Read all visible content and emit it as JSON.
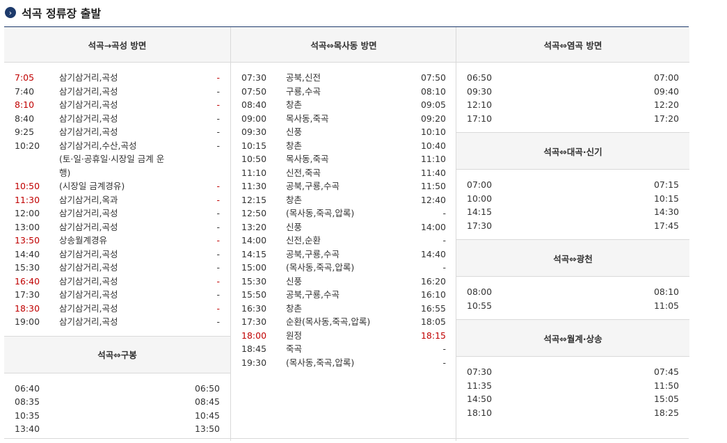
{
  "title": "석곡 정류장 출발",
  "title_icon": "chevron-right-icon",
  "accent_color": "#1d3a6b",
  "highlight_color": "#c00000",
  "sections": {
    "goksung": {
      "header": "석곡→곡성 방면",
      "rows": [
        {
          "time": "7:05",
          "via": "삼기삼거리,곡성",
          "arr": "-",
          "red": true
        },
        {
          "time": "7:40",
          "via": "삼기삼거리,곡성",
          "arr": "-"
        },
        {
          "time": "8:10",
          "via": "삼기삼거리,곡성",
          "arr": "-",
          "red": true
        },
        {
          "time": "8:40",
          "via": "삼기삼거리,곡성",
          "arr": "-"
        },
        {
          "time": "9:25",
          "via": "삼기삼거리,곡성",
          "arr": "-"
        },
        {
          "time": "10:20",
          "via": "삼기삼거리,수산,곡성",
          "arr": "-"
        },
        {
          "time": "",
          "via": "(토·일·공휴일·시장일 금계 운",
          "arr": ""
        },
        {
          "time": "",
          "via": "행)",
          "arr": ""
        },
        {
          "time": "10:50",
          "via": "(시장일 금계경유)",
          "arr": "-",
          "red": true
        },
        {
          "time": "11:30",
          "via": "삼기삼거리,옥과",
          "arr": "-",
          "red": true
        },
        {
          "time": "12:00",
          "via": "삼기삼거리,곡성",
          "arr": "-"
        },
        {
          "time": "13:00",
          "via": "삼기삼거리,곡성",
          "arr": "-"
        },
        {
          "time": "13:50",
          "via": "상송월계경유",
          "arr": "-",
          "red": true
        },
        {
          "time": "14:40",
          "via": "삼기삼거리,곡성",
          "arr": "-"
        },
        {
          "time": "15:30",
          "via": "삼기삼거리,곡성",
          "arr": "-"
        },
        {
          "time": "16:40",
          "via": "삼기삼거리,곡성",
          "arr": "-",
          "red": true
        },
        {
          "time": "17:30",
          "via": "삼기삼거리,곡성",
          "arr": "-"
        },
        {
          "time": "18:30",
          "via": "삼기삼거리,곡성",
          "arr": "-",
          "red": true
        },
        {
          "time": "19:00",
          "via": "삼기삼거리,곡성",
          "arr": "-"
        }
      ]
    },
    "gubong": {
      "header": "석곡⇔구봉",
      "rows": [
        {
          "time": "06:40",
          "via": "",
          "arr": "06:50"
        },
        {
          "time": "08:35",
          "via": "",
          "arr": "08:45"
        },
        {
          "time": "10:35",
          "via": "",
          "arr": "10:45"
        },
        {
          "time": "13:40",
          "via": "",
          "arr": "13:50"
        }
      ]
    },
    "moksadong": {
      "header": "석곡⇔목사동 방면",
      "rows": [
        {
          "time": "07:30",
          "via": "공북,신전",
          "arr": "07:50"
        },
        {
          "time": "07:50",
          "via": "구룡,수곡",
          "arr": "08:10"
        },
        {
          "time": "08:40",
          "via": "창촌",
          "arr": "09:05"
        },
        {
          "time": "09:00",
          "via": "목사동,죽곡",
          "arr": "09:20"
        },
        {
          "time": "09:30",
          "via": "신풍",
          "arr": "10:10"
        },
        {
          "time": "10:15",
          "via": "창촌",
          "arr": "10:40"
        },
        {
          "time": "10:50",
          "via": "목사동,죽곡",
          "arr": "11:10"
        },
        {
          "time": "11:10",
          "via": "신전,죽곡",
          "arr": "11:40"
        },
        {
          "time": "11:30",
          "via": "공북,구룡,수곡",
          "arr": "11:50"
        },
        {
          "time": "12:15",
          "via": "창촌",
          "arr": "12:40"
        },
        {
          "time": "12:50",
          "via": "(목사동,죽곡,압록)",
          "arr": "-"
        },
        {
          "time": "13:20",
          "via": "신풍",
          "arr": "14:00"
        },
        {
          "time": "14:00",
          "via": "신전,순환",
          "arr": "-"
        },
        {
          "time": "14:15",
          "via": "공북,구룡,수곡",
          "arr": "14:40"
        },
        {
          "time": "15:00",
          "via": "(목사동,죽곡,압록)",
          "arr": "-"
        },
        {
          "time": "15:30",
          "via": "신풍",
          "arr": "16:20"
        },
        {
          "time": "15:50",
          "via": "공북,구룡,수곡",
          "arr": "16:10"
        },
        {
          "time": "16:30",
          "via": "창촌",
          "arr": "16:55"
        },
        {
          "time": "17:30",
          "via": "순환(목사동,죽곡,압록)",
          "arr": "18:05"
        },
        {
          "time": "18:00",
          "via": "원정",
          "arr": "18:15",
          "red": true
        },
        {
          "time": "18:45",
          "via": "죽곡",
          "arr": "-"
        },
        {
          "time": "19:30",
          "via": "(목사동,죽곡,압록)",
          "arr": "-"
        }
      ]
    },
    "yeomgok": {
      "header": "석곡⇔염곡 방면",
      "rows": [
        {
          "time": "06:50",
          "via": "",
          "arr": "07:00"
        },
        {
          "time": "09:30",
          "via": "",
          "arr": "09:40"
        },
        {
          "time": "12:10",
          "via": "",
          "arr": "12:20"
        },
        {
          "time": "17:10",
          "via": "",
          "arr": "17:20"
        }
      ]
    },
    "daegok": {
      "header": "석곡⇔대곡·신기",
      "rows": [
        {
          "time": "07:00",
          "via": "",
          "arr": "07:15"
        },
        {
          "time": "10:00",
          "via": "",
          "arr": "10:15"
        },
        {
          "time": "14:15",
          "via": "",
          "arr": "14:30"
        },
        {
          "time": "17:30",
          "via": "",
          "arr": "17:45"
        }
      ]
    },
    "gwangcheon": {
      "header": "석곡⇔광천",
      "rows": [
        {
          "time": "08:00",
          "via": "",
          "arr": "08:10"
        },
        {
          "time": "10:55",
          "via": "",
          "arr": "11:05"
        }
      ]
    },
    "wolgye": {
      "header": "석곡⇔월계·상송",
      "rows": [
        {
          "time": "07:30",
          "via": "",
          "arr": "07:45"
        },
        {
          "time": "11:35",
          "via": "",
          "arr": "11:50"
        },
        {
          "time": "14:50",
          "via": "",
          "arr": "15:05"
        },
        {
          "time": "18:10",
          "via": "",
          "arr": "18:25"
        }
      ]
    }
  }
}
